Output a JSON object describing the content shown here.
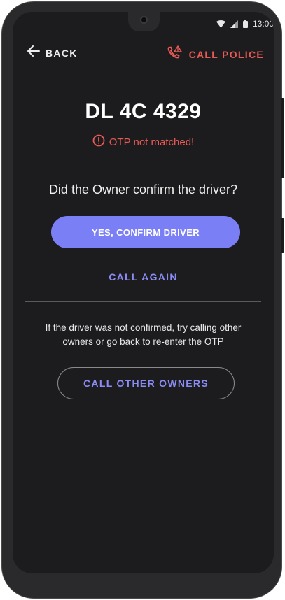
{
  "status_bar": {
    "time": "13:00"
  },
  "topbar": {
    "back_label": "BACK",
    "police_label": "CALL POLICE"
  },
  "vehicle": {
    "plate": "DL 4C 4329"
  },
  "otp": {
    "error_text": "OTP not matched!"
  },
  "prompt": {
    "question": "Did the Owner confirm the driver?"
  },
  "actions": {
    "confirm_label": "YES, CONFIRM DRIVER",
    "call_again_label": "CALL AGAIN",
    "info_text": "If the driver was not confirmed, try calling other owners or go back to re-enter the OTP",
    "call_other_label": "CALL OTHER OWNERS"
  },
  "colors": {
    "accent": "#7b7ff5",
    "accent_text": "#8a8cf5",
    "error": "#e85a55",
    "background": "#1c1b1d"
  },
  "icons": [
    "arrow-left-icon",
    "phone-alert-icon",
    "alert-circle-icon",
    "wifi-icon",
    "signal-icon",
    "battery-icon"
  ]
}
